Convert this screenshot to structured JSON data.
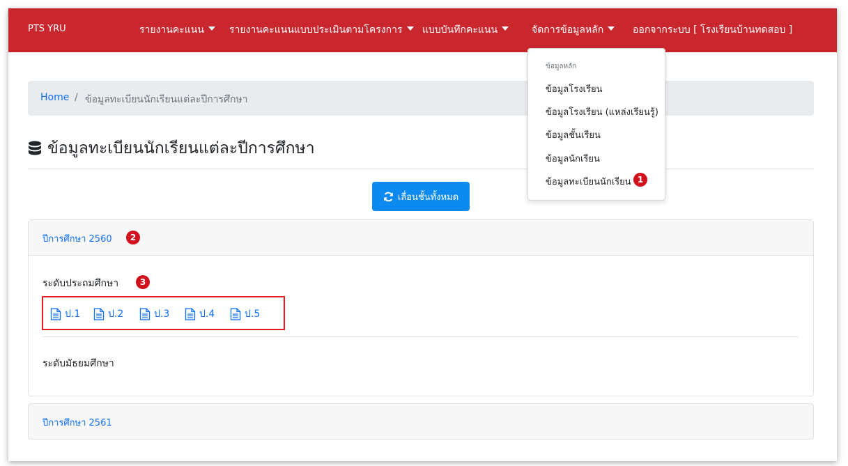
{
  "navbar": {
    "brand": "PTS YRU",
    "items": [
      {
        "label": "รายงานคะแนน"
      },
      {
        "label": "รายงานคะแนนแบบประเมินตามโครงการ"
      },
      {
        "label": "แบบบันทึกคะแนน"
      },
      {
        "label": "จัดการข้อมูลหลัก"
      },
      {
        "label": "ออกจากระบบ [ โรงเรียนบ้านทดสอบ ]"
      }
    ],
    "bg_color": "#c9262e"
  },
  "dropdown": {
    "header": "ข้อมูลหลัก",
    "items": [
      {
        "label": "ข้อมูลโรงเรียน"
      },
      {
        "label": "ข้อมูลโรงเรียน (แหล่งเรียนรู้)"
      },
      {
        "label": "ข้อมูลชั้นเรียน"
      },
      {
        "label": "ข้อมูลนักเรียน"
      },
      {
        "label": "ข้อมูลทะเบียนนักเรียน"
      }
    ]
  },
  "breadcrumb": {
    "home": "Home",
    "separator": "/",
    "current": "ข้อมูลทะเบียนนักเรียนแต่ละปีการศึกษา"
  },
  "page": {
    "title": "ข้อมูลทะเบียนนักเรียนแต่ละปีการศึกษา",
    "title_icon": "database-icon",
    "promote_button": "เลื่อนชั้นทั้งหมด",
    "promote_icon": "sync-icon"
  },
  "years": [
    {
      "label": "ปีการศึกษา 2560",
      "levels": [
        {
          "label": "ระดับประถมศึกษา",
          "classes": [
            "ป.1",
            "ป.2",
            "ป.3",
            "ป.4",
            "ป.5"
          ]
        },
        {
          "label": "ระดับมัธยมศึกษา",
          "classes": []
        }
      ]
    },
    {
      "label": "ปีการศึกษา 2561"
    }
  ],
  "annotations": {
    "badge1": "1",
    "badge2": "2",
    "badge3": "3",
    "badge_color": "#d1111b"
  },
  "colors": {
    "primary": "#0d8af0",
    "link": "#0d6efd",
    "highlight_box": "#e41b23"
  }
}
